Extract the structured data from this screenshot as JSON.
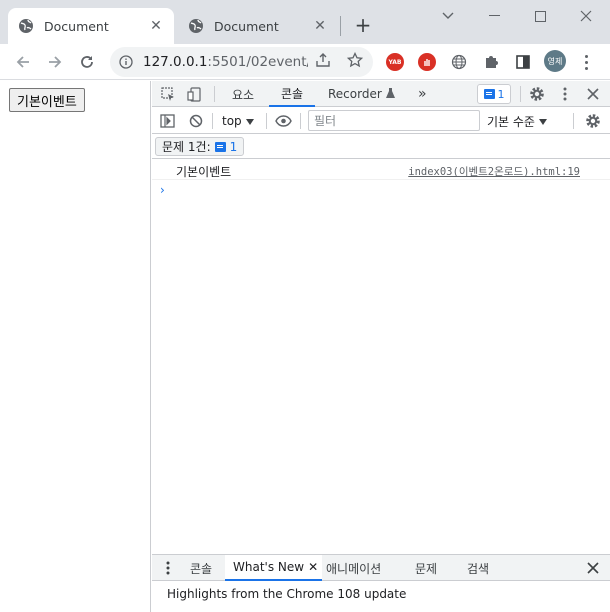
{
  "browser": {
    "tabs": [
      {
        "title": "Document",
        "active": true
      },
      {
        "title": "Document",
        "active": false
      }
    ],
    "address": {
      "url_main": "127.0.0.1",
      "url_rest": ":5501/02event/..."
    },
    "extensions": [
      {
        "name": "yab-icon",
        "label": "YAB",
        "color": "#d93025"
      },
      {
        "name": "stop-hand-icon",
        "label": "",
        "color": "#d93025"
      },
      {
        "name": "globe-icon",
        "label": "",
        "color": "#5f6368"
      },
      {
        "name": "puzzle-icon",
        "label": "",
        "color": "#5f6368"
      }
    ],
    "profile_initial": "영제"
  },
  "page": {
    "button_label": "기본이벤트"
  },
  "devtools": {
    "tabs": [
      "요소",
      "콘솔",
      "Recorder",
      "»"
    ],
    "active_tab": "콘솔",
    "issue_count": "1",
    "context": "top",
    "filter_placeholder": "필터",
    "level": "기본 수준",
    "issues_label": "문제 1건:",
    "issues_count": "1",
    "console": {
      "message": "기본이벤트",
      "source": "index03(이벤트2온로드).html:19"
    },
    "drawer": {
      "tabs": [
        "콘솔",
        "What's New",
        "애니메이션",
        "문제",
        "검색"
      ],
      "active": "What's New",
      "highlight": "Highlights from the Chrome 108 update"
    }
  },
  "colors": {
    "accent": "#1a73e8",
    "chrome_bg": "#dee1e6",
    "devtools_bar": "#f1f3f4"
  }
}
